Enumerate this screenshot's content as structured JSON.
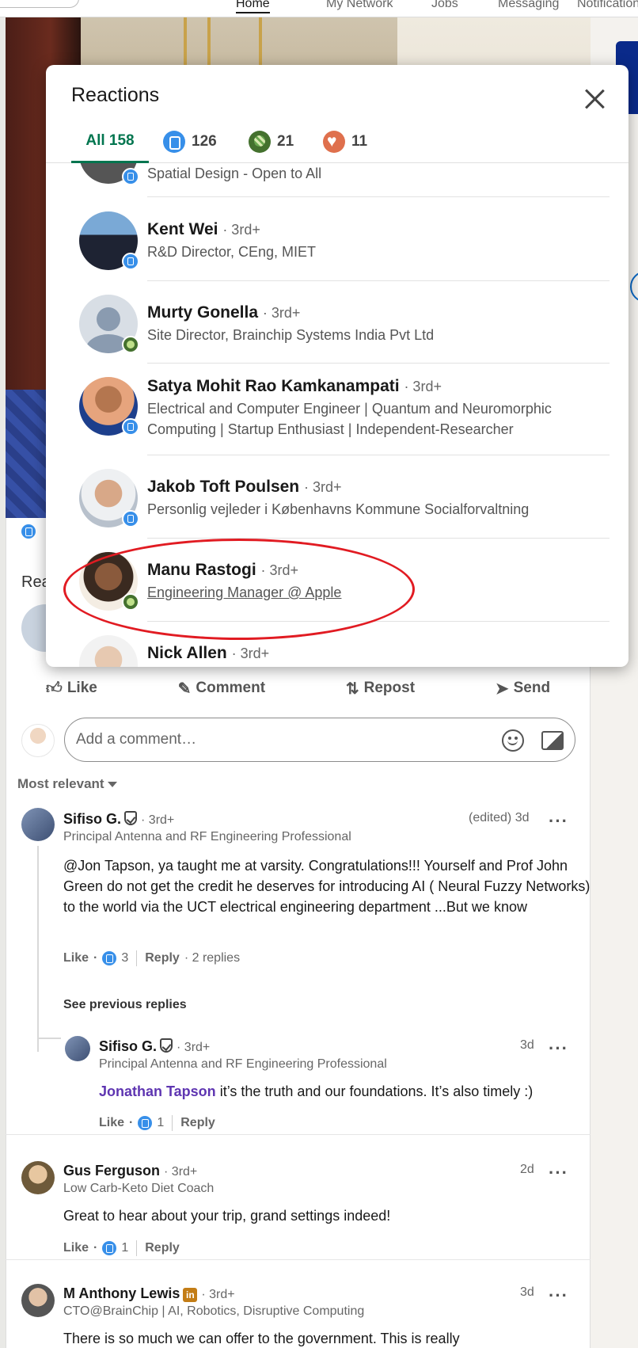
{
  "nav": {
    "items": [
      "Home",
      "My Network",
      "Jobs",
      "Messaging",
      "Notifications"
    ],
    "active": "Home"
  },
  "post": {
    "actions": {
      "like": "Like",
      "comment": "Comment",
      "repost": "Repost",
      "send": "Send"
    },
    "background_label": "Rea",
    "comment_input": {
      "placeholder": "Add a comment…"
    },
    "sort_label": "Most relevant"
  },
  "comments": [
    {
      "author": "Sifiso G.",
      "degree": "· 3rd+",
      "headline": "Principal Antenna and RF Engineering Professional",
      "time": "(edited) 3d",
      "text": "@Jon Tapson, ya taught me at varsity. Congratulations!!! Yourself and Prof John Green do not get the credit he deserves for introducing AI ( Neural Fuzzy Networks) to the world via the UCT electrical engineering department ...But we know",
      "like_label": "Like",
      "like_count": "3",
      "reply_label": "Reply",
      "replies_label": "· 2 replies"
    },
    {
      "author": "Sifiso G.",
      "degree": "· 3rd+",
      "headline": "Principal Antenna and RF Engineering Professional",
      "time": "3d",
      "mention": "Jonathan Tapson",
      "text": " it’s the truth and our foundations. It’s also timely :)",
      "like_label": "Like",
      "like_count": "1",
      "reply_label": "Reply"
    },
    {
      "author": "Gus Ferguson",
      "degree": "· 3rd+",
      "headline": "Low Carb-Keto Diet Coach",
      "time": "2d",
      "text": "Great to hear about your trip, grand settings indeed!",
      "like_label": "Like",
      "like_count": "1",
      "reply_label": "Reply"
    },
    {
      "author": "M Anthony Lewis",
      "degree": "· 3rd+",
      "headline": "CTO@BrainChip | AI, Robotics, Disruptive Computing",
      "time": "3d",
      "text": "There is so much we can offer to the government. This is really"
    }
  ],
  "see_previous_replies": "See previous replies",
  "modal": {
    "title": "Reactions",
    "tabs": [
      {
        "label": "All 158",
        "icon": "none"
      },
      {
        "label": "126",
        "icon": "like-icon"
      },
      {
        "label": "21",
        "icon": "celebrate-icon"
      },
      {
        "label": "11",
        "icon": "love-icon"
      }
    ],
    "people": [
      {
        "name": "",
        "degree": "",
        "headline": "Spatial Design - Open to All",
        "reaction": "like"
      },
      {
        "name": "Kent Wei",
        "degree": "· 3rd+",
        "headline": "R&D Director, CEng, MIET",
        "reaction": "like"
      },
      {
        "name": "Murty Gonella",
        "degree": "· 3rd+",
        "headline": "Site Director, Brainchip Systems India Pvt Ltd",
        "reaction": "celebrate"
      },
      {
        "name": "Satya Mohit Rao Kamkanampati",
        "degree": "· 3rd+",
        "headline": "Electrical and Computer Engineer | Quantum and Neuromorphic Computing | Startup Enthusiast | Independent-Researcher",
        "reaction": "like"
      },
      {
        "name": "Jakob Toft Poulsen",
        "degree": "· 3rd+",
        "headline": "Personlig vejleder i Københavns Kommune Socialforvaltning",
        "reaction": "like"
      },
      {
        "name": "Manu Rastogi",
        "degree": "· 3rd+",
        "headline": "Engineering Manager @ Apple",
        "reaction": "celebrate"
      },
      {
        "name": "Nick Allen",
        "degree": "· 3rd+",
        "headline": "",
        "reaction": "like"
      }
    ]
  },
  "colors": {
    "accent_green": "#01754f",
    "like_blue": "#378fe9",
    "celebrate_green": "#44712e",
    "love_orange": "#df704d",
    "annotation_red": "#e11b22",
    "mention_purple": "#5e35b1"
  }
}
